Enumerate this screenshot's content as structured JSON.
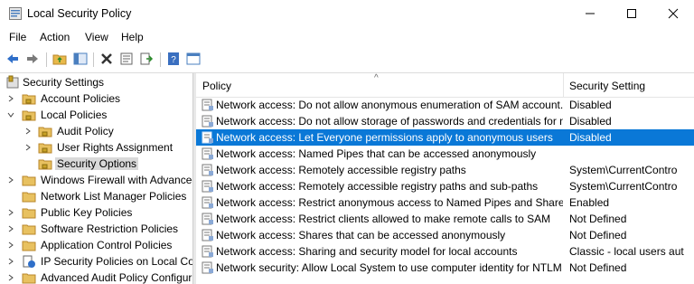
{
  "window": {
    "title": "Local Security Policy"
  },
  "menu": [
    "File",
    "Action",
    "View",
    "Help"
  ],
  "tree": [
    {
      "label": "Security Settings",
      "icon": "shield-icon"
    },
    {
      "label": "Account Policies",
      "icon": "folder-lock-icon"
    },
    {
      "label": "Local Policies",
      "icon": "folder-lock-icon"
    },
    {
      "label": "Audit Policy",
      "icon": "folder-lock-icon"
    },
    {
      "label": "User Rights Assignment",
      "icon": "folder-lock-icon"
    },
    {
      "label": "Security Options",
      "icon": "folder-lock-icon"
    },
    {
      "label": "Windows Firewall with Advanced",
      "icon": "folder-icon"
    },
    {
      "label": "Network List Manager Policies",
      "icon": "folder-icon"
    },
    {
      "label": "Public Key Policies",
      "icon": "folder-icon"
    },
    {
      "label": "Software Restriction Policies",
      "icon": "folder-icon"
    },
    {
      "label": "Application Control Policies",
      "icon": "folder-icon"
    },
    {
      "label": "IP Security Policies on Local Co",
      "icon": "ip-security-icon"
    },
    {
      "label": "Advanced Audit Policy Configur",
      "icon": "folder-icon"
    }
  ],
  "list": {
    "columns": {
      "policy": "Policy",
      "setting": "Security Setting"
    },
    "rows": [
      {
        "policy": "Network access: Do not allow anonymous enumeration of SAM account...",
        "setting": "Disabled"
      },
      {
        "policy": "Network access: Do not allow storage of passwords and credentials for n...",
        "setting": "Disabled"
      },
      {
        "policy": "Network access: Let Everyone permissions apply to anonymous users",
        "setting": "Disabled"
      },
      {
        "policy": "Network access: Named Pipes that can be accessed anonymously",
        "setting": ""
      },
      {
        "policy": "Network access: Remotely accessible registry paths",
        "setting": "System\\CurrentContro"
      },
      {
        "policy": "Network access: Remotely accessible registry paths and sub-paths",
        "setting": "System\\CurrentContro"
      },
      {
        "policy": "Network access: Restrict anonymous access to Named Pipes and Shares",
        "setting": "Enabled"
      },
      {
        "policy": "Network access: Restrict clients allowed to make remote calls to SAM",
        "setting": "Not Defined"
      },
      {
        "policy": "Network access: Shares that can be accessed anonymously",
        "setting": "Not Defined"
      },
      {
        "policy": "Network access: Sharing and security model for local accounts",
        "setting": "Classic - local users aut"
      },
      {
        "policy": "Network security: Allow Local System to use computer identity for NTLM",
        "setting": "Not Defined"
      }
    ]
  },
  "colors": {
    "selection": "#0a78d7",
    "tree_selection": "#d9d9d9"
  }
}
